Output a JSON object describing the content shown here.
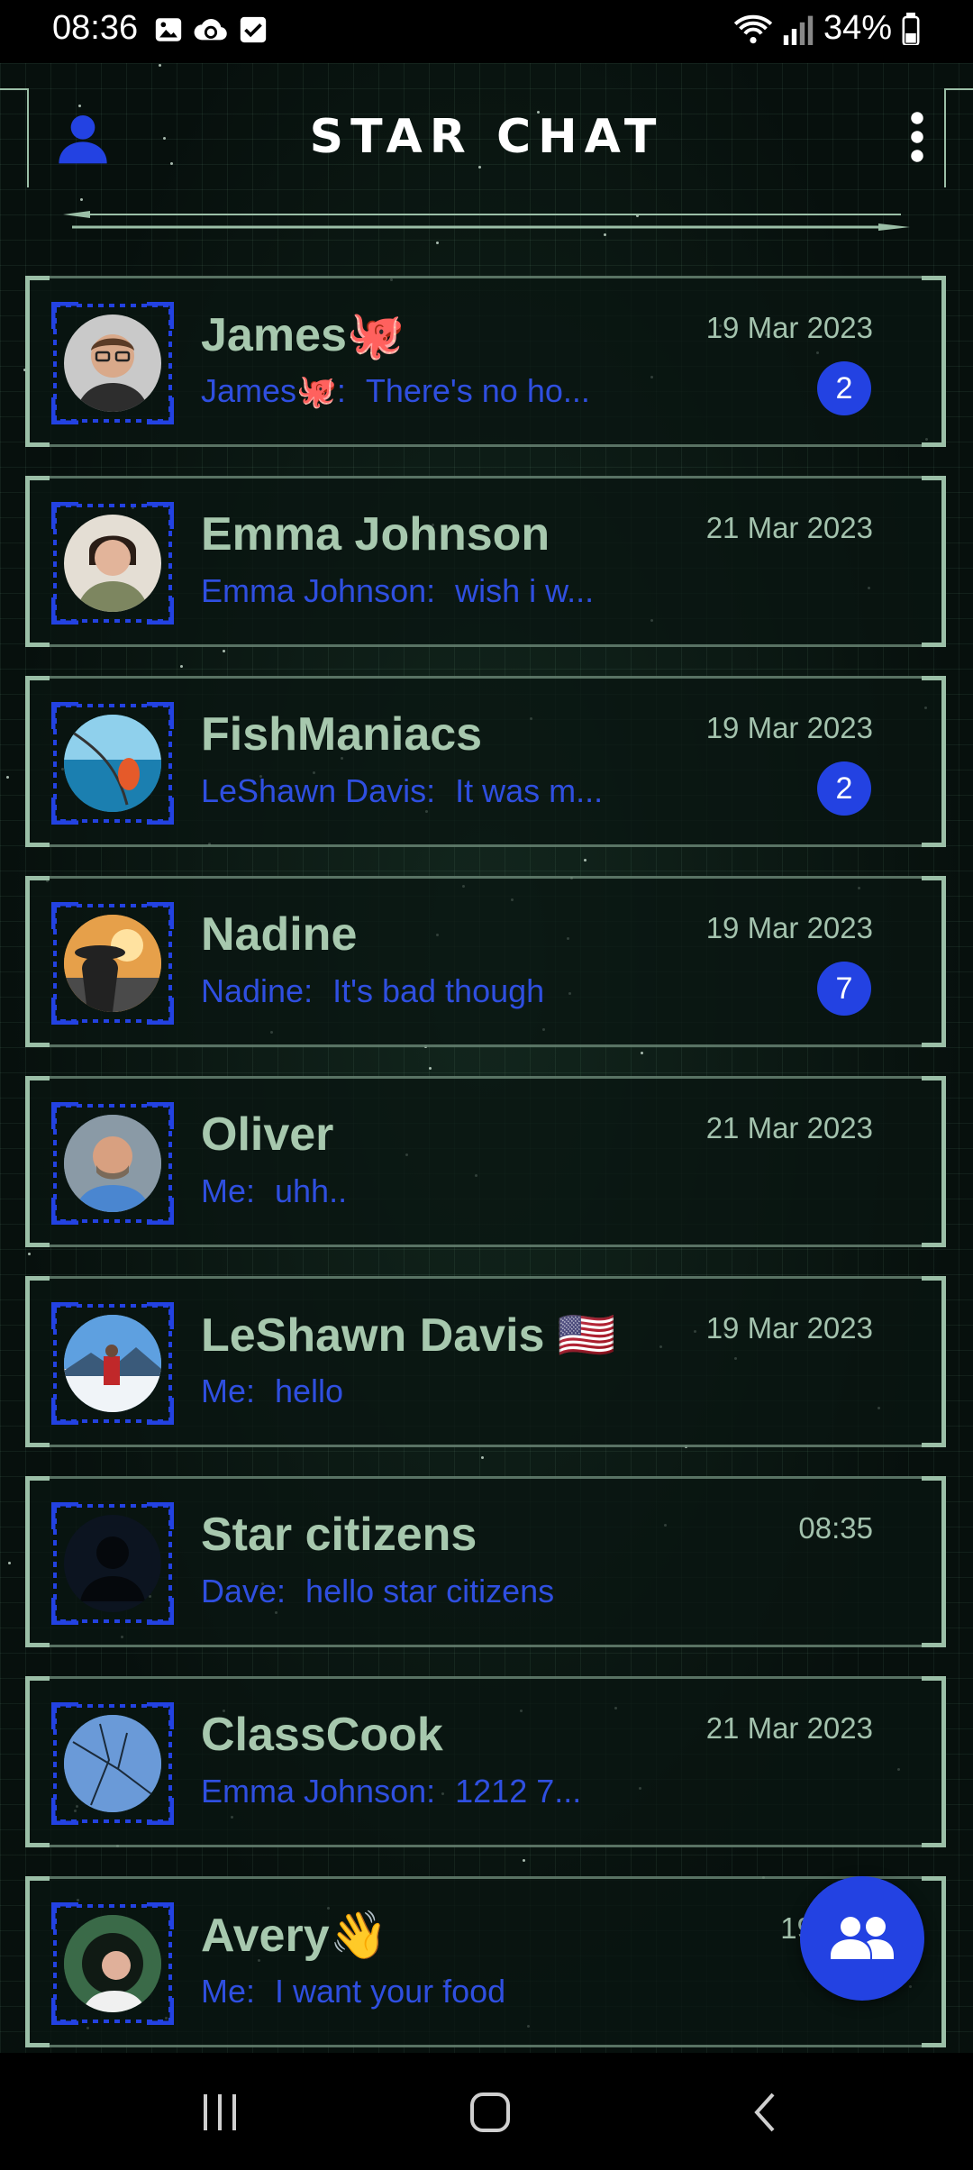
{
  "status_bar": {
    "time": "08:36",
    "battery": "34%"
  },
  "header": {
    "title": "STAR  CHAT"
  },
  "chats": [
    {
      "name": "James🐙",
      "sender": "James🐙:",
      "message": "There's no ho...",
      "date": "19 Mar 2023",
      "unread": "2",
      "avatar_color": "#c9c9c9"
    },
    {
      "name": "Emma Johnson",
      "sender": "Emma Johnson:",
      "message": "wish i w...",
      "date": "21 Mar 2023",
      "unread": null,
      "avatar_color": "#d8d2c8"
    },
    {
      "name": "FishManiacs",
      "sender": "LeShawn Davis:",
      "message": "It was m...",
      "date": "19 Mar 2023",
      "unread": "2",
      "avatar_color": "#3fa0c8"
    },
    {
      "name": "Nadine",
      "sender": "Nadine:",
      "message": "It's bad though",
      "date": "19 Mar 2023",
      "unread": "7",
      "avatar_color": "#d98a3a"
    },
    {
      "name": "Oliver",
      "sender": "Me:",
      "message": "uhh..",
      "date": "21 Mar 2023",
      "unread": null,
      "avatar_color": "#6a8fb0"
    },
    {
      "name": "LeShawn Davis 🇺🇸",
      "sender": "Me:",
      "message": "hello",
      "date": "19 Mar 2023",
      "unread": null,
      "avatar_color": "#7fb2e0"
    },
    {
      "name": "Star citizens",
      "sender": "Dave:",
      "message": "hello star citizens",
      "date": "08:35",
      "unread": null,
      "avatar_color": "#0c1420"
    },
    {
      "name": "ClassCook",
      "sender": "Emma Johnson:",
      "message": "1212 7...",
      "date": "21 Mar 2023",
      "unread": null,
      "avatar_color": "#5b8fcf"
    },
    {
      "name": "Avery👋",
      "sender": "Me:",
      "message": "I want your food",
      "date": "19 Mar",
      "unread": null,
      "avatar_color": "#2e5a3a"
    }
  ],
  "colors": {
    "accent": "#2342e2",
    "frame": "#9bbfa7",
    "name": "#a7c8ae",
    "preview": "#2f4fe0"
  },
  "icons": {
    "fab": "group-icon",
    "profile": "person-icon",
    "menu": "more-vert-icon"
  }
}
